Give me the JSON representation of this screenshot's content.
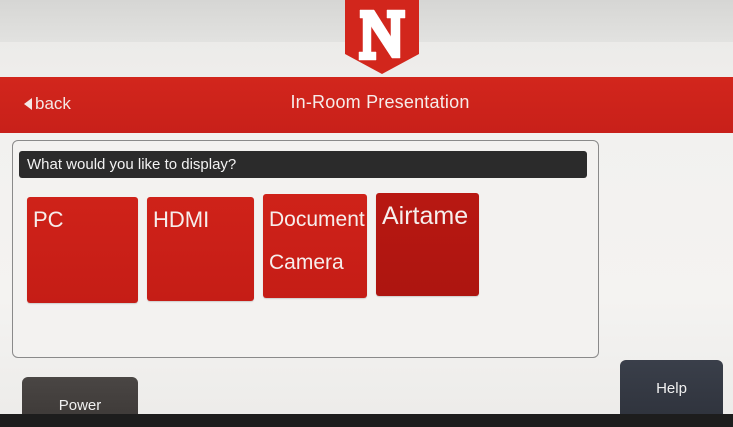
{
  "header": {
    "back_label": "back",
    "title": "In-Room Presentation"
  },
  "logo": {
    "letter": "N",
    "color": "#d2261c"
  },
  "panel": {
    "prompt": "What would you like to display?",
    "sources": [
      {
        "label": "PC"
      },
      {
        "label": "HDMI"
      },
      {
        "label": "Document Camera"
      },
      {
        "label": "Airtame",
        "selected": true
      }
    ]
  },
  "footer": {
    "power_label": "Power",
    "help_label": "Help"
  },
  "colors": {
    "accent_red": "#d2261c",
    "dark_bar": "#2b2b2b",
    "power_button": "#4a4644",
    "help_button": "#3a3f4a"
  }
}
